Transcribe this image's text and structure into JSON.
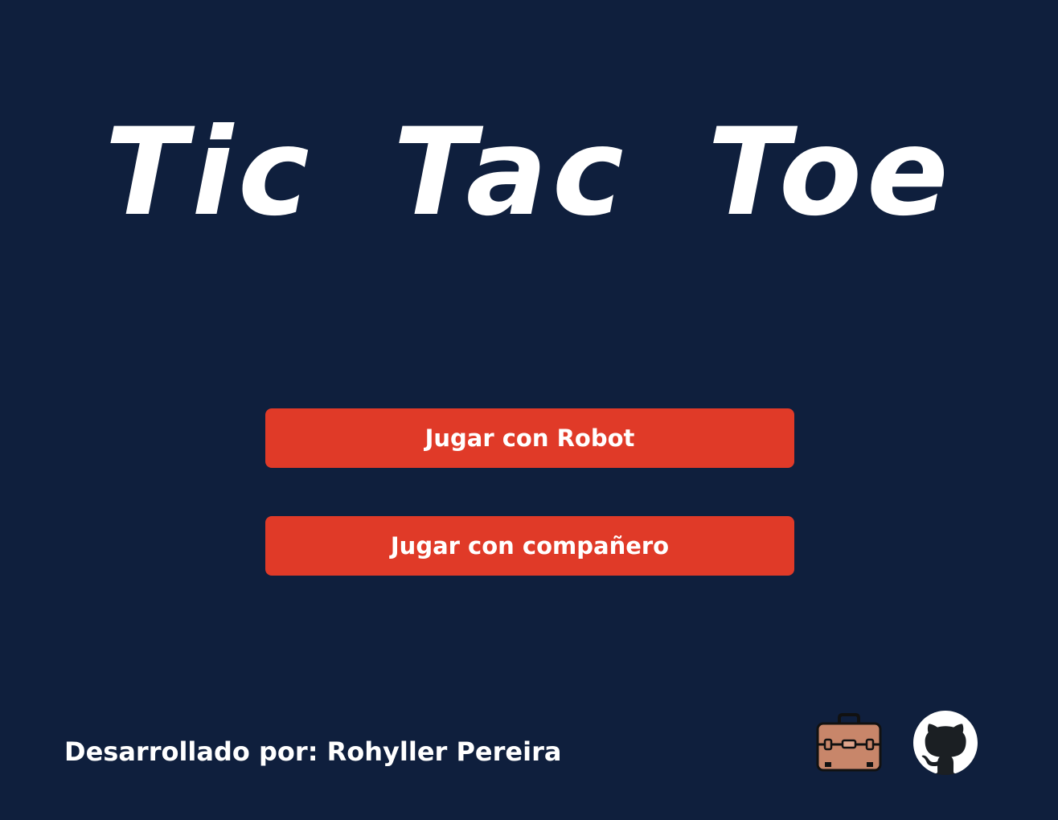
{
  "title": "Tic Tac Toe",
  "buttons": {
    "robot_label": "Jugar con Robot",
    "friend_label": "Jugar con compañero"
  },
  "footer": {
    "credits": "Desarrollado por: Rohyller Pereira",
    "icons": [
      "briefcase-icon",
      "github-icon"
    ]
  },
  "colors": {
    "background": "#0f1f3d",
    "button": "#e03a28",
    "text": "#ffffff",
    "briefcase": "#c8866a",
    "github_circle": "#1b1f23"
  }
}
